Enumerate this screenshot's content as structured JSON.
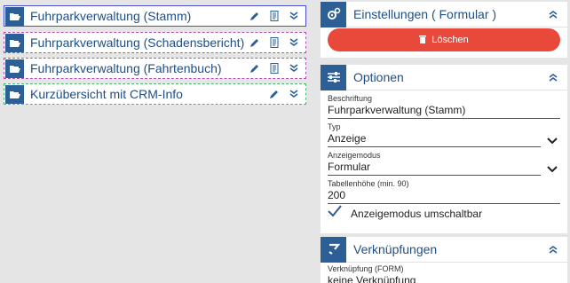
{
  "forms": [
    {
      "title": "Fuhrparkverwaltung (Stamm)",
      "border": "solid-blue",
      "icons": [
        "folder-open-icon",
        "pencil-icon",
        "document-icon",
        "double-chevron-down-icon"
      ]
    },
    {
      "title": "Fuhrparkverwaltung (Schadensbericht)",
      "border": "dashed-purple",
      "icons": [
        "folder-open-icon",
        "pencil-icon",
        "document-icon",
        "double-chevron-down-icon"
      ]
    },
    {
      "title": "Fuhrparkverwaltung (Fahrtenbuch)",
      "border": "dashed-purple",
      "icons": [
        "folder-open-icon",
        "pencil-icon",
        "document-icon",
        "double-chevron-down-icon"
      ]
    },
    {
      "title": "Kurzübersicht mit CRM-Info",
      "border": "dashed-green",
      "icons": [
        "folder-open-icon",
        "pencil-icon",
        "double-chevron-down-icon"
      ]
    }
  ],
  "settings": {
    "title": "Einstellungen ( Formular )",
    "delete_label": "Löschen"
  },
  "options": {
    "title": "Optionen",
    "caption_label": "Beschriftung",
    "caption_value": "Fuhrparkverwaltung (Stamm)",
    "type_label": "Typ",
    "type_value": "Anzeige",
    "mode_label": "Anzeigemodus",
    "mode_value": "Formular",
    "height_label": "Tabellenhöhe (min. 90)",
    "height_value": "200",
    "toggle_label": "Anzeigemodus umschaltbar",
    "toggle_checked": true
  },
  "links": {
    "title": "Verknüpfungen",
    "link_label": "Verknüpfung (FORM)",
    "link_value": "keine Verknüpfung"
  },
  "colors": {
    "accent": "#2c5f96",
    "delete": "#e8493a",
    "title_text": "#1f4e86",
    "background": "#e5e5e5"
  }
}
